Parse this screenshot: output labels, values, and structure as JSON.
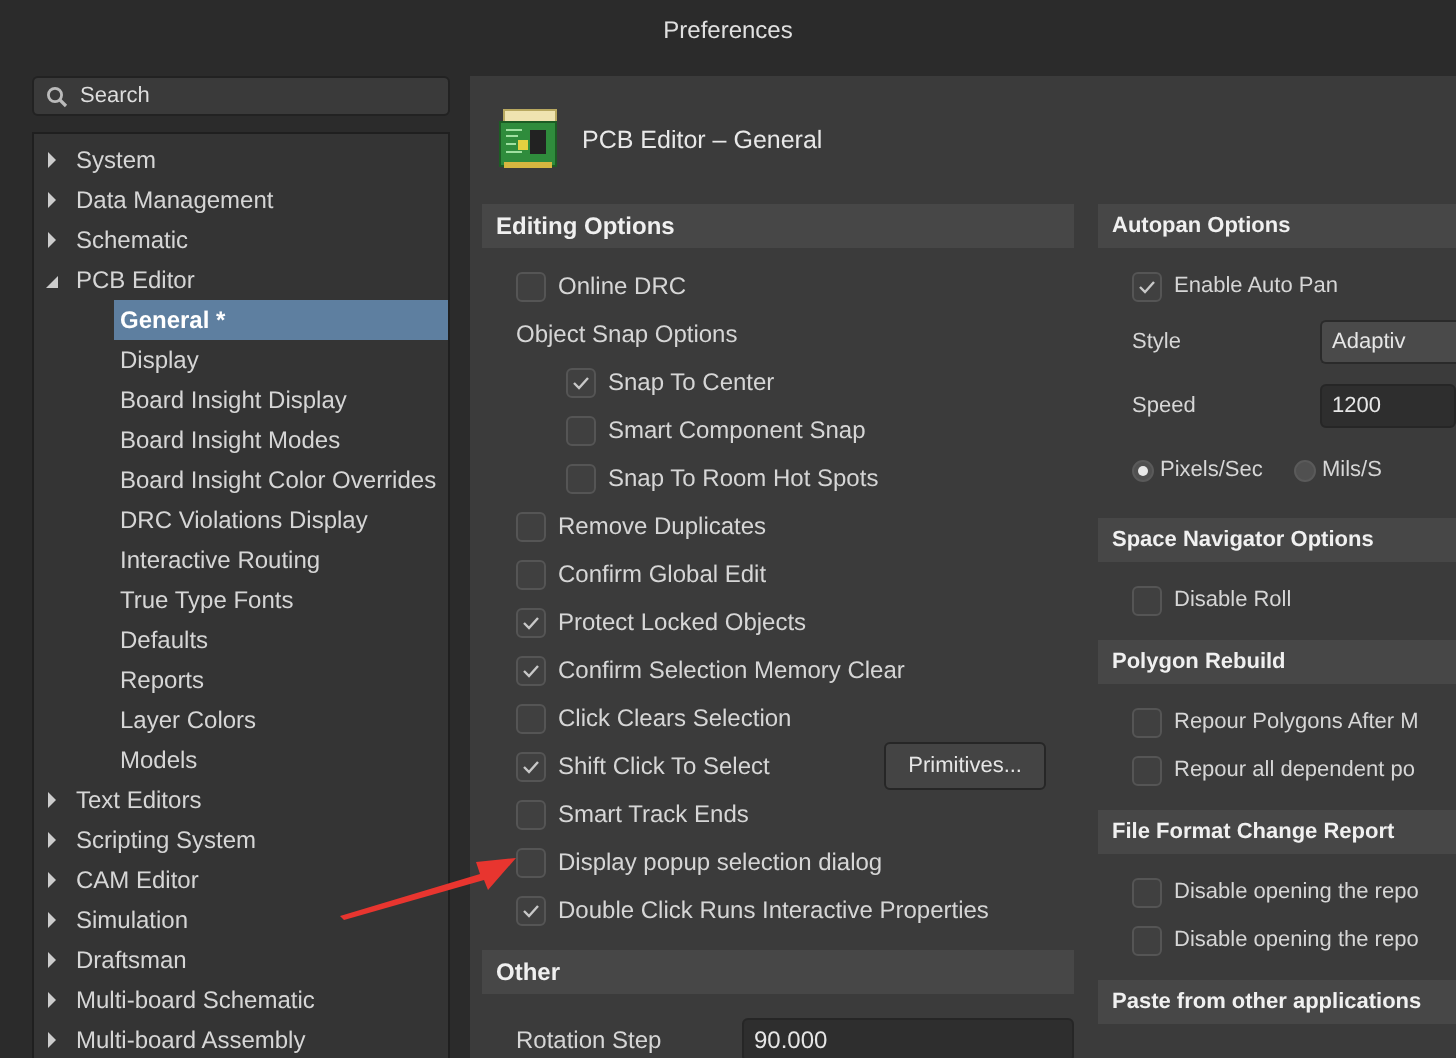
{
  "window": {
    "title": "Preferences"
  },
  "search": {
    "placeholder": "Search"
  },
  "tree": [
    {
      "label": "System",
      "expanded": false,
      "selected": false
    },
    {
      "label": "Data Management",
      "expanded": false,
      "selected": false
    },
    {
      "label": "Schematic",
      "expanded": false,
      "selected": false
    },
    {
      "label": "PCB Editor",
      "expanded": true,
      "selected": false,
      "children": [
        {
          "label": "General *",
          "selected": true
        },
        {
          "label": "Display",
          "selected": false
        },
        {
          "label": "Board Insight Display",
          "selected": false
        },
        {
          "label": "Board Insight Modes",
          "selected": false
        },
        {
          "label": "Board Insight Color Overrides",
          "selected": false
        },
        {
          "label": "DRC Violations Display",
          "selected": false
        },
        {
          "label": "Interactive Routing",
          "selected": false
        },
        {
          "label": "True Type Fonts",
          "selected": false
        },
        {
          "label": "Defaults",
          "selected": false
        },
        {
          "label": "Reports",
          "selected": false
        },
        {
          "label": "Layer Colors",
          "selected": false
        },
        {
          "label": "Models",
          "selected": false
        }
      ]
    },
    {
      "label": "Text Editors",
      "expanded": false,
      "selected": false
    },
    {
      "label": "Scripting System",
      "expanded": false,
      "selected": false
    },
    {
      "label": "CAM Editor",
      "expanded": false,
      "selected": false
    },
    {
      "label": "Simulation",
      "expanded": false,
      "selected": false
    },
    {
      "label": "Draftsman",
      "expanded": false,
      "selected": false
    },
    {
      "label": "Multi-board Schematic",
      "expanded": false,
      "selected": false
    },
    {
      "label": "Multi-board Assembly",
      "expanded": false,
      "selected": false
    }
  ],
  "page": {
    "title": "PCB Editor – General"
  },
  "left_sections": [
    {
      "title": "Editing Options",
      "items": [
        {
          "kind": "checkbox",
          "label": "Online DRC",
          "checked": false
        },
        {
          "kind": "group",
          "label": "Object Snap Options",
          "children": [
            {
              "kind": "checkbox",
              "label": "Snap To Center",
              "checked": true
            },
            {
              "kind": "checkbox",
              "label": "Smart Component Snap",
              "checked": false
            },
            {
              "kind": "checkbox",
              "label": "Snap To Room Hot Spots",
              "checked": false
            }
          ]
        },
        {
          "kind": "checkbox",
          "label": "Remove Duplicates",
          "checked": false
        },
        {
          "kind": "checkbox",
          "label": "Confirm Global Edit",
          "checked": false
        },
        {
          "kind": "checkbox",
          "label": "Protect Locked Objects",
          "checked": true
        },
        {
          "kind": "checkbox",
          "label": "Confirm Selection Memory Clear",
          "checked": true
        },
        {
          "kind": "checkbox",
          "label": "Click Clears Selection",
          "checked": false
        },
        {
          "kind": "checkbox",
          "label": "Shift Click To Select",
          "checked": true,
          "button": "Primitives..."
        },
        {
          "kind": "checkbox",
          "label": "Smart Track Ends",
          "checked": false
        },
        {
          "kind": "checkbox",
          "label": "Display popup selection dialog",
          "checked": false
        },
        {
          "kind": "checkbox",
          "label": "Double Click Runs Interactive Properties",
          "checked": true
        }
      ]
    },
    {
      "title": "Other",
      "items": [
        {
          "kind": "field",
          "label": "Rotation Step",
          "value": "90.000"
        }
      ]
    }
  ],
  "right_sections": [
    {
      "title": "Autopan Options",
      "items": [
        {
          "kind": "checkbox",
          "label": "Enable Auto Pan",
          "checked": true
        },
        {
          "kind": "dropdown",
          "label": "Style",
          "value": "Adaptiv"
        },
        {
          "kind": "field",
          "label": "Speed",
          "value": "1200"
        },
        {
          "kind": "radios",
          "options": [
            {
              "label": "Pixels/Sec",
              "selected": true
            },
            {
              "label": "Mils/S",
              "selected": false
            }
          ]
        }
      ]
    },
    {
      "title": "Space Navigator Options",
      "items": [
        {
          "kind": "checkbox",
          "label": "Disable Roll",
          "checked": false
        }
      ]
    },
    {
      "title": "Polygon Rebuild",
      "items": [
        {
          "kind": "checkbox",
          "label": "Repour Polygons After M",
          "checked": false
        },
        {
          "kind": "checkbox",
          "label": "Repour all dependent po",
          "checked": false
        }
      ]
    },
    {
      "title": "File Format Change Report",
      "items": [
        {
          "kind": "checkbox",
          "label": "Disable opening the repo",
          "checked": false
        },
        {
          "kind": "checkbox",
          "label": "Disable opening the repo",
          "checked": false
        }
      ]
    },
    {
      "title": "Paste from other applications"
    }
  ]
}
